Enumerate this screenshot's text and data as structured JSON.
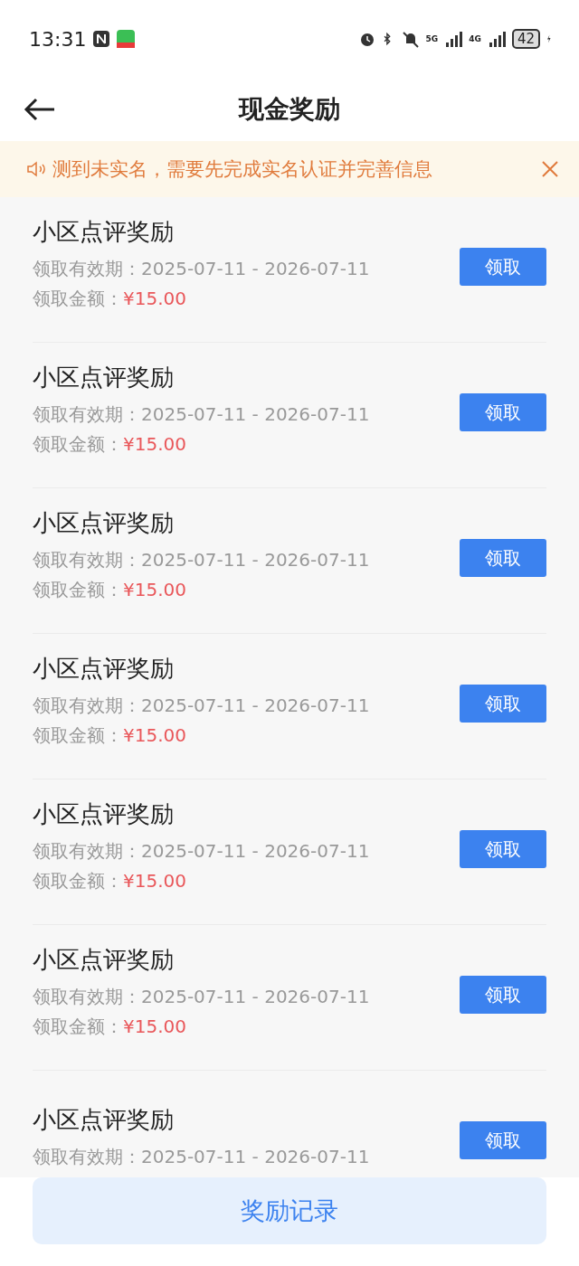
{
  "status_bar": {
    "time": "13:31",
    "network_5g": "5G",
    "network_4g": "4G",
    "battery": "42"
  },
  "header": {
    "title": "现金奖励"
  },
  "notice": {
    "text": "测到未实名，需要先完成实名认证并完善信息"
  },
  "rewards": [
    {
      "title": "小区点评奖励",
      "validity_label": "领取有效期：",
      "validity": "2025-07-11 - 2026-07-11",
      "amount_label": "领取金额：",
      "amount": "¥15.00",
      "button": "领取"
    },
    {
      "title": "小区点评奖励",
      "validity_label": "领取有效期：",
      "validity": "2025-07-11 - 2026-07-11",
      "amount_label": "领取金额：",
      "amount": "¥15.00",
      "button": "领取"
    },
    {
      "title": "小区点评奖励",
      "validity_label": "领取有效期：",
      "validity": "2025-07-11 - 2026-07-11",
      "amount_label": "领取金额：",
      "amount": "¥15.00",
      "button": "领取"
    },
    {
      "title": "小区点评奖励",
      "validity_label": "领取有效期：",
      "validity": "2025-07-11 - 2026-07-11",
      "amount_label": "领取金额：",
      "amount": "¥15.00",
      "button": "领取"
    },
    {
      "title": "小区点评奖励",
      "validity_label": "领取有效期：",
      "validity": "2025-07-11 - 2026-07-11",
      "amount_label": "领取金额：",
      "amount": "¥15.00",
      "button": "领取"
    },
    {
      "title": "小区点评奖励",
      "validity_label": "领取有效期：",
      "validity": "2025-07-11 - 2026-07-11",
      "amount_label": "领取金额：",
      "amount": "¥15.00",
      "button": "领取"
    },
    {
      "title": "小区点评奖励",
      "validity_label": "领取有效期：",
      "validity": "2025-07-11 - 2026-07-11",
      "button": "领取"
    }
  ],
  "footer": {
    "button": "奖励记录"
  }
}
